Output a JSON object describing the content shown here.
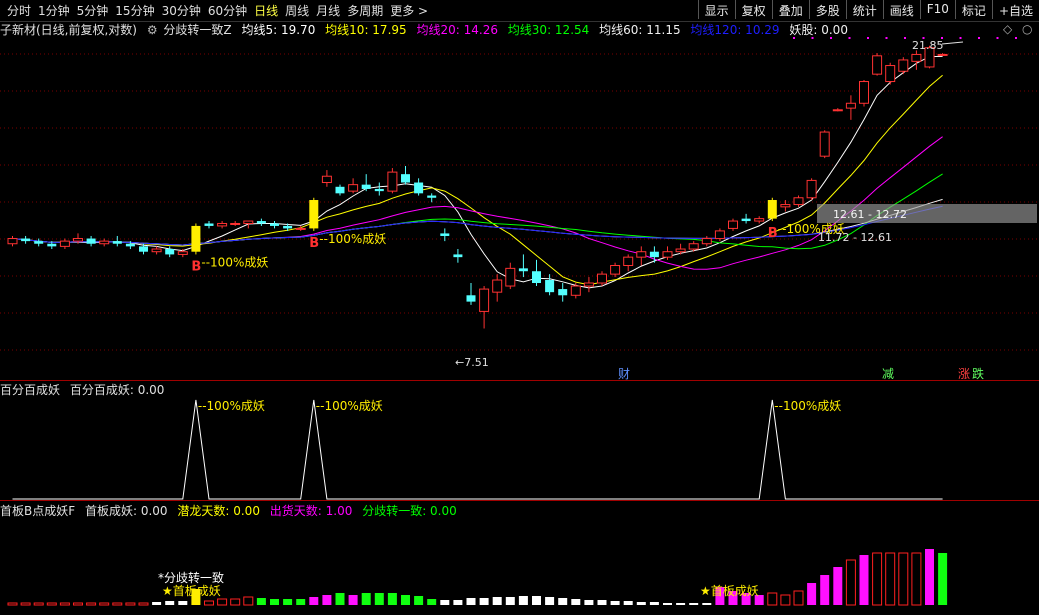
{
  "toolbar": {
    "periods": [
      "分时",
      "1分钟",
      "5分钟",
      "15分钟",
      "30分钟",
      "60分钟",
      "日线",
      "周线",
      "月线",
      "多周期",
      "更多 >"
    ],
    "active": "日线",
    "buttons": [
      "显示",
      "复权",
      "叠加",
      "多股",
      "统计",
      "画线",
      "F10",
      "标记",
      "+自选"
    ]
  },
  "main_info": {
    "name": "子新材(日线,前复权,对数)",
    "indicator": "分歧转一致Z",
    "ma5": "均线5: 19.70",
    "ma10": "均线10: 17.95",
    "ma20": "均线20: 14.26",
    "ma30": "均线30: 12.54",
    "ma60": "均线60: 11.15",
    "ma120": "均线120: 10.29",
    "yaogu": "妖股: 0.00"
  },
  "colors": {
    "ma5": "#ffffff",
    "ma10": "#ffff00",
    "ma20": "#ff00ff",
    "ma30": "#00ff00",
    "ma60": "#f0f0f0",
    "ma120": "#1e1eff",
    "up": "#ff3232",
    "down": "#54ffff",
    "signal": "#ffee00",
    "magenta": "#ff00ff"
  },
  "annotations": {
    "high": "21.85",
    "low": "←7.51",
    "range1": "12.61 - 12.72",
    "range2": "11.72 - 12.61",
    "signal_text": "--100%成妖",
    "b_mark": "B",
    "cai": "财",
    "jian": "减",
    "zhang": "涨",
    "die": "跌"
  },
  "panel2_info": {
    "name": "百分百成妖",
    "value": "百分百成妖: 0.00",
    "peak_label": "--100%成妖"
  },
  "panel3_info": {
    "name": "首板B点成妖F",
    "sbcy": "首板成妖: 0.00",
    "qlts": "潜龙天数: 0.00",
    "chts": "出货天数: 1.00",
    "fqzyz": "分歧转一致: 0.00",
    "label_fq": "*分歧转一致",
    "label_sb": "★首板成妖"
  },
  "chart_data": {
    "type": "candlestick",
    "candles": [
      [
        1,
        11.0,
        11.3,
        10.9,
        11.2
      ],
      [
        2,
        11.2,
        11.3,
        11.0,
        11.1
      ],
      [
        3,
        11.1,
        11.2,
        10.9,
        11.0
      ],
      [
        4,
        11.0,
        11.1,
        10.8,
        10.9
      ],
      [
        5,
        10.9,
        11.2,
        10.8,
        11.1
      ],
      [
        6,
        11.1,
        11.4,
        11.0,
        11.2
      ],
      [
        7,
        11.2,
        11.3,
        10.9,
        11.0
      ],
      [
        8,
        11.0,
        11.2,
        10.9,
        11.1
      ],
      [
        9,
        11.1,
        11.3,
        10.9,
        11.0
      ],
      [
        10,
        11.0,
        11.1,
        10.8,
        10.9
      ],
      [
        11,
        10.9,
        11.0,
        10.6,
        10.7
      ],
      [
        12,
        10.7,
        10.9,
        10.6,
        10.8
      ],
      [
        13,
        10.8,
        10.9,
        10.5,
        10.6
      ],
      [
        14,
        10.6,
        10.8,
        10.5,
        10.7
      ],
      [
        15,
        10.7,
        11.8,
        10.6,
        11.7
      ],
      [
        16,
        11.8,
        11.9,
        11.6,
        11.7
      ],
      [
        17,
        11.7,
        11.9,
        11.6,
        11.8
      ],
      [
        18,
        11.8,
        11.9,
        11.7,
        11.8
      ],
      [
        19,
        11.8,
        11.9,
        11.6,
        11.9
      ],
      [
        20,
        11.9,
        12.0,
        11.7,
        11.8
      ],
      [
        21,
        11.8,
        11.9,
        11.6,
        11.7
      ],
      [
        22,
        11.7,
        11.8,
        11.5,
        11.6
      ],
      [
        23,
        11.6,
        11.7,
        11.5,
        11.6
      ],
      [
        24,
        11.6,
        12.9,
        11.5,
        12.8
      ],
      [
        25,
        13.6,
        14.2,
        13.4,
        13.9
      ],
      [
        26,
        13.4,
        13.5,
        13.0,
        13.1
      ],
      [
        27,
        13.2,
        13.8,
        13.1,
        13.5
      ],
      [
        28,
        13.5,
        14.0,
        13.2,
        13.3
      ],
      [
        29,
        13.3,
        13.6,
        13.0,
        13.2
      ],
      [
        30,
        13.2,
        14.3,
        13.1,
        14.1
      ],
      [
        31,
        14.0,
        14.4,
        13.5,
        13.6
      ],
      [
        32,
        13.6,
        13.8,
        13.0,
        13.1
      ],
      [
        33,
        13.0,
        13.1,
        12.7,
        12.9
      ],
      [
        34,
        11.4,
        11.6,
        11.1,
        11.3
      ],
      [
        35,
        10.6,
        10.8,
        10.3,
        10.5
      ],
      [
        36,
        9.2,
        9.6,
        8.9,
        9.0
      ],
      [
        37,
        8.7,
        9.5,
        8.2,
        9.4
      ],
      [
        38,
        9.3,
        9.9,
        9.0,
        9.7
      ],
      [
        39,
        9.5,
        10.3,
        9.4,
        10.1
      ],
      [
        40,
        10.1,
        10.6,
        9.8,
        10.0
      ],
      [
        41,
        10.0,
        10.4,
        9.5,
        9.6
      ],
      [
        42,
        9.7,
        9.9,
        9.2,
        9.3
      ],
      [
        43,
        9.4,
        9.6,
        9.0,
        9.2
      ],
      [
        44,
        9.2,
        9.6,
        9.1,
        9.5
      ],
      [
        45,
        9.5,
        9.8,
        9.3,
        9.6
      ],
      [
        46,
        9.6,
        10.0,
        9.5,
        9.9
      ],
      [
        47,
        9.9,
        10.3,
        9.8,
        10.2
      ],
      [
        48,
        10.2,
        10.6,
        10.0,
        10.5
      ],
      [
        49,
        10.5,
        10.9,
        10.2,
        10.7
      ],
      [
        50,
        10.7,
        10.9,
        10.3,
        10.5
      ],
      [
        51,
        10.5,
        10.9,
        10.4,
        10.7
      ],
      [
        52,
        10.7,
        11.0,
        10.6,
        10.8
      ],
      [
        53,
        10.8,
        11.1,
        10.7,
        11.0
      ],
      [
        54,
        11.0,
        11.3,
        10.9,
        11.2
      ],
      [
        55,
        11.2,
        11.6,
        11.1,
        11.5
      ],
      [
        56,
        11.6,
        12.0,
        11.5,
        11.9
      ],
      [
        57,
        12.0,
        12.2,
        11.8,
        11.9
      ],
      [
        58,
        11.9,
        12.1,
        11.8,
        12.0
      ],
      [
        59,
        12.0,
        12.9,
        11.9,
        12.8
      ],
      [
        60,
        12.5,
        12.8,
        12.3,
        12.6
      ],
      [
        61,
        12.6,
        13.0,
        12.5,
        12.9
      ],
      [
        62,
        12.9,
        13.8,
        12.8,
        13.7
      ],
      [
        63,
        14.9,
        16.3,
        14.8,
        16.2
      ],
      [
        64,
        17.5,
        17.6,
        17.4,
        17.5
      ],
      [
        65,
        17.6,
        18.4,
        16.9,
        17.9
      ],
      [
        66,
        17.9,
        19.4,
        17.7,
        19.3
      ],
      [
        67,
        19.8,
        21.3,
        19.7,
        21.1
      ],
      [
        68,
        19.3,
        20.6,
        19.1,
        20.4
      ],
      [
        69,
        20.0,
        21.0,
        19.8,
        20.8
      ],
      [
        70,
        20.7,
        21.5,
        20.1,
        21.2
      ],
      [
        71,
        20.3,
        21.85,
        20.2,
        21.7
      ],
      [
        72,
        21.2,
        21.3,
        21.1,
        21.2
      ]
    ],
    "signal_bars_x": [
      15,
      24,
      59
    ],
    "peaks_x": [
      15,
      24,
      59
    ],
    "panel3_bars": [
      [
        1,
        2,
        "r"
      ],
      [
        2,
        2,
        "r"
      ],
      [
        3,
        2,
        "r"
      ],
      [
        4,
        2,
        "r"
      ],
      [
        5,
        2,
        "r"
      ],
      [
        6,
        2,
        "r"
      ],
      [
        7,
        2,
        "r"
      ],
      [
        8,
        2,
        "r"
      ],
      [
        9,
        2,
        "r"
      ],
      [
        10,
        2,
        "r"
      ],
      [
        11,
        2,
        "r"
      ],
      [
        12,
        3,
        "w"
      ],
      [
        13,
        4,
        "w"
      ],
      [
        14,
        4,
        "w"
      ],
      [
        15,
        16,
        "y"
      ],
      [
        16,
        4,
        "r"
      ],
      [
        17,
        6,
        "r"
      ],
      [
        18,
        6,
        "r"
      ],
      [
        19,
        8,
        "r"
      ],
      [
        20,
        7,
        "g"
      ],
      [
        21,
        6,
        "g"
      ],
      [
        22,
        6,
        "g"
      ],
      [
        23,
        6,
        "g"
      ],
      [
        24,
        8,
        "m"
      ],
      [
        25,
        10,
        "m"
      ],
      [
        26,
        12,
        "g"
      ],
      [
        27,
        10,
        "m"
      ],
      [
        28,
        12,
        "g"
      ],
      [
        29,
        12,
        "g"
      ],
      [
        30,
        12,
        "g"
      ],
      [
        31,
        10,
        "g"
      ],
      [
        32,
        9,
        "g"
      ],
      [
        33,
        6,
        "g"
      ],
      [
        34,
        5,
        "w"
      ],
      [
        35,
        5,
        "w"
      ],
      [
        36,
        7,
        "w"
      ],
      [
        37,
        7,
        "w"
      ],
      [
        38,
        8,
        "w"
      ],
      [
        39,
        8,
        "w"
      ],
      [
        40,
        9,
        "w"
      ],
      [
        41,
        9,
        "w"
      ],
      [
        42,
        8,
        "w"
      ],
      [
        43,
        7,
        "w"
      ],
      [
        44,
        6,
        "w"
      ],
      [
        45,
        5,
        "w"
      ],
      [
        46,
        5,
        "w"
      ],
      [
        47,
        4,
        "w"
      ],
      [
        48,
        4,
        "w"
      ],
      [
        49,
        3,
        "w"
      ],
      [
        50,
        3,
        "w"
      ],
      [
        51,
        2,
        "w"
      ],
      [
        52,
        2,
        "w"
      ],
      [
        53,
        2,
        "w"
      ],
      [
        54,
        2,
        "w"
      ],
      [
        55,
        18,
        "m"
      ],
      [
        56,
        14,
        "m"
      ],
      [
        57,
        12,
        "m"
      ],
      [
        58,
        10,
        "m"
      ],
      [
        59,
        12,
        "r"
      ],
      [
        60,
        10,
        "r"
      ],
      [
        61,
        14,
        "r"
      ],
      [
        62,
        22,
        "m"
      ],
      [
        63,
        30,
        "m"
      ],
      [
        64,
        38,
        "m"
      ],
      [
        65,
        45,
        "r"
      ],
      [
        66,
        50,
        "m"
      ],
      [
        67,
        52,
        "r"
      ],
      [
        68,
        52,
        "r"
      ],
      [
        69,
        52,
        "r"
      ],
      [
        70,
        52,
        "r"
      ],
      [
        71,
        56,
        "m"
      ],
      [
        72,
        52,
        "g"
      ]
    ]
  }
}
